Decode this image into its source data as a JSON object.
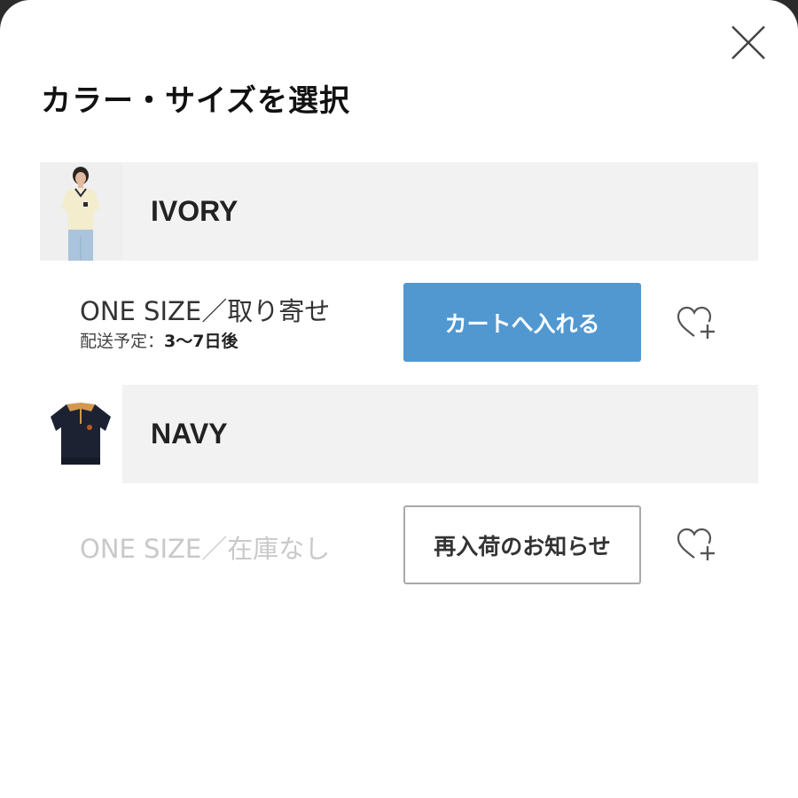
{
  "dialog": {
    "title": "カラー・サイズを選択"
  },
  "variants": [
    {
      "color": "IVORY",
      "size_status": "ONE SIZE／取り寄せ",
      "delivery_label": "配送予定：",
      "delivery_value": "3〜7日後",
      "action_label": "カートへ入れる",
      "in_stock": true
    },
    {
      "color": "NAVY",
      "size_status": "ONE SIZE／在庫なし",
      "action_label": "再入荷のお知らせ",
      "in_stock": false
    }
  ],
  "colors": {
    "cart_button": "#5198d1",
    "row_background": "#f2f2f2",
    "out_of_stock_text": "#c9c9c9"
  },
  "icons": {
    "close": "close-icon",
    "favorite": "heart-plus-icon"
  }
}
